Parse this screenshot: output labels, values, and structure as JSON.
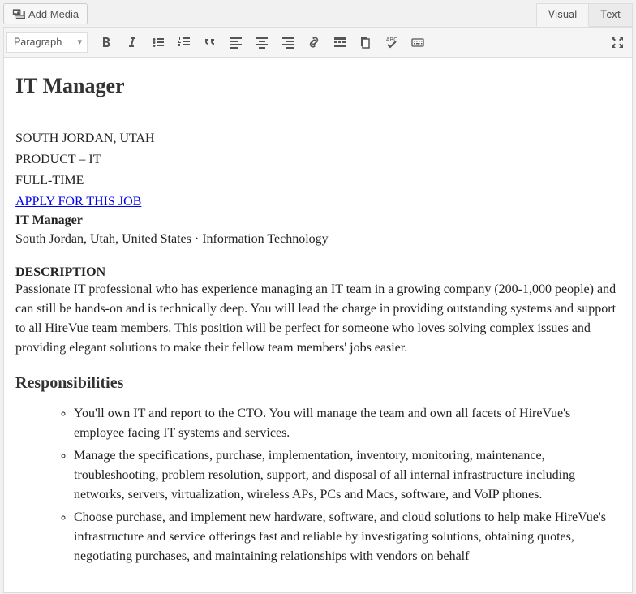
{
  "toolbar": {
    "add_media": "Add Media",
    "tabs": {
      "visual": "Visual",
      "text": "Text"
    },
    "format_select": "Paragraph"
  },
  "content": {
    "title": "IT Manager",
    "location_line": "SOUTH JORDAN, UTAH",
    "dept_line": "PRODUCT – IT",
    "type_line": "FULL-TIME",
    "apply_link": "APPLY FOR THIS JOB",
    "subtitle": "IT Manager",
    "meta_line": "South Jordan, Utah, United States · Information Technology",
    "desc_header": "DESCRIPTION",
    "desc_body": "Passionate IT professional who has experience managing an IT team in a growing company (200-1,000 people) and can still be hands-on and is technically deep. You will lead the charge in providing outstanding systems and support to all HireVue team members. This position will be perfect for someone who loves solving complex issues and providing elegant solutions to make their fellow team members' jobs easier.",
    "resp_header": "Responsibilities",
    "resp_items": [
      "You'll own IT and report to the CTO. You will manage the team and own all facets of HireVue's employee facing IT systems and services.",
      "Manage the specifications, purchase, implementation, inventory, monitoring, maintenance, troubleshooting, problem resolution, support, and disposal of all internal infrastructure including networks, servers, virtualization, wireless APs, PCs and Macs, software, and VoIP phones.",
      "Choose purchase, and implement new hardware, software, and cloud solutions to help make HireVue's infrastructure and service offerings fast and reliable by investigating solutions, obtaining quotes, negotiating purchases, and maintaining relationships with vendors on behalf"
    ]
  }
}
